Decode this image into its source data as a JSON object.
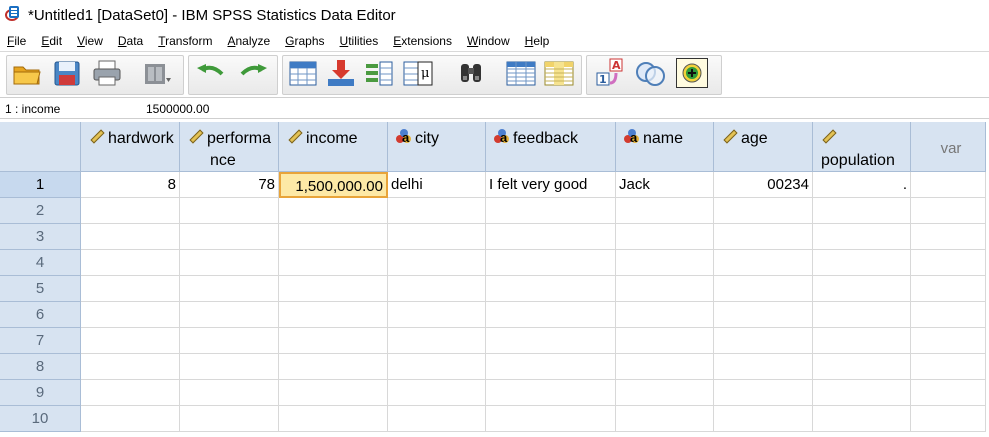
{
  "window": {
    "title": "*Untitled1 [DataSet0] - IBM SPSS Statistics Data Editor"
  },
  "menu": [
    {
      "key": "F",
      "rest": "ile"
    },
    {
      "key": "E",
      "rest": "dit"
    },
    {
      "key": "V",
      "rest": "iew"
    },
    {
      "key": "D",
      "rest": "ata"
    },
    {
      "key": "T",
      "rest": "ransform"
    },
    {
      "key": "A",
      "rest": "nalyze"
    },
    {
      "key": "G",
      "rest": "raphs"
    },
    {
      "key": "U",
      "rest": "tilities"
    },
    {
      "key": "E",
      "rest": "xtensions"
    },
    {
      "key": "W",
      "rest": "indow"
    },
    {
      "key": "H",
      "rest": "elp"
    }
  ],
  "toolbar": {
    "icons": [
      "open-folder-icon",
      "save-icon",
      "print-icon",
      "dialog-recall-icon",
      "undo-icon",
      "redo-icon",
      "goto-case-icon",
      "goto-variable-icon",
      "variables-icon",
      "run-descriptives-icon",
      "find-icon",
      "insert-cases-icon",
      "insert-variable-icon",
      "split-file-icon",
      "weight-cases-icon",
      "select-cases-icon",
      "value-labels-icon",
      "use-sets-icon"
    ]
  },
  "cellbar": {
    "reference": "1 : income",
    "value": "1500000.00"
  },
  "columns": [
    {
      "name": "hardwork",
      "measure": "scale"
    },
    {
      "name": "performa nce",
      "line1": "performa",
      "line2": "nce",
      "measure": "scale"
    },
    {
      "name": "income",
      "measure": "scale"
    },
    {
      "name": "city",
      "measure": "nominal"
    },
    {
      "name": "feedback",
      "measure": "nominal"
    },
    {
      "name": "name",
      "measure": "nominal"
    },
    {
      "name": "age",
      "measure": "scale"
    },
    {
      "name": "population",
      "measure": "scale"
    },
    {
      "name": "var",
      "measure": "none"
    }
  ],
  "rows": [
    {
      "num": "1",
      "cells": [
        "8",
        "78",
        "1,500,000.00",
        "delhi",
        "I felt very good",
        "Jack",
        "00234",
        ".",
        ""
      ]
    },
    {
      "num": "2",
      "cells": []
    },
    {
      "num": "3",
      "cells": []
    },
    {
      "num": "4",
      "cells": []
    },
    {
      "num": "5",
      "cells": []
    },
    {
      "num": "6",
      "cells": []
    },
    {
      "num": "7",
      "cells": []
    },
    {
      "num": "8",
      "cells": []
    },
    {
      "num": "9",
      "cells": []
    },
    {
      "num": "10",
      "cells": []
    }
  ],
  "selected_cell": {
    "row": 1,
    "column": "income"
  },
  "colors": {
    "header_bg": "#d7e3f1",
    "selected_cell": "#fde9a6",
    "selected_border": "#e8a43a"
  }
}
